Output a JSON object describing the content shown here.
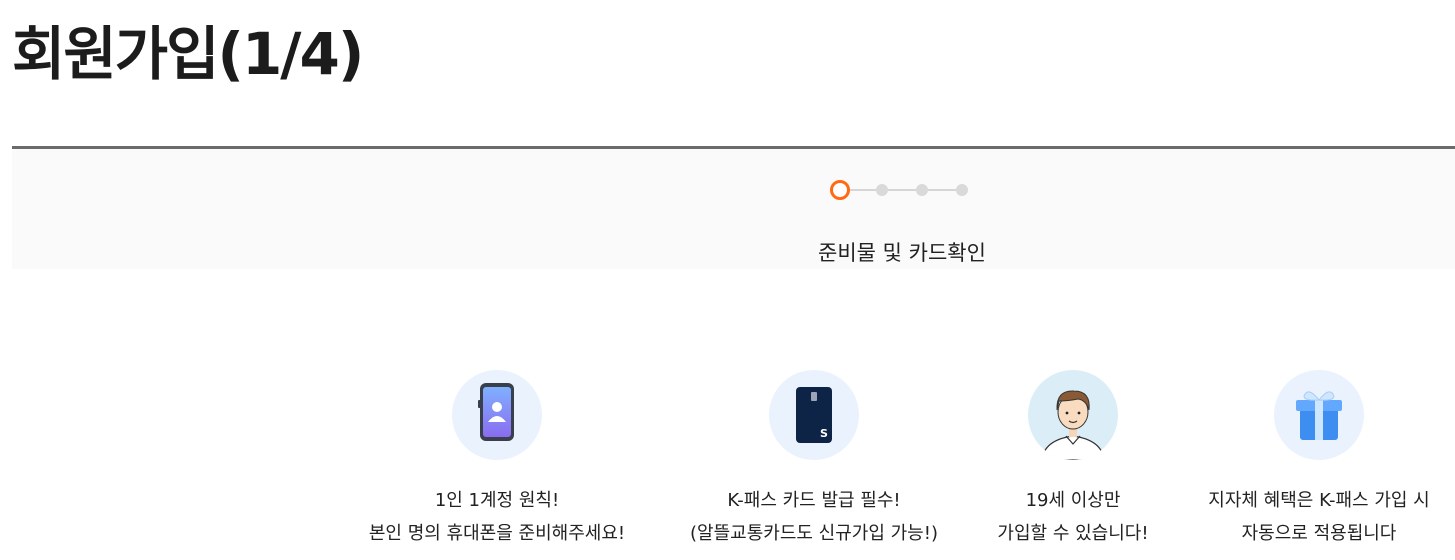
{
  "page": {
    "title": "회원가입(1/4)"
  },
  "stepper": {
    "current_step_label": "준비물 및 카드확인",
    "colors": {
      "active": "#ff6a13",
      "inactive": "#d9d9d9"
    }
  },
  "info_items": [
    {
      "icon": "smartphone-user-icon",
      "line1": "1인 1계정 원칙!",
      "line2": "본인 명의 휴대폰을 준비해주세요!"
    },
    {
      "icon": "kpass-card-icon",
      "line1": "K-패스 카드 발급 필수!",
      "line2": "(알뜰교통카드도 신규가입 가능!)"
    },
    {
      "icon": "adult-person-icon",
      "line1": "19세 이상만",
      "line2": "가입할 수 있습니다!"
    },
    {
      "icon": "gift-box-icon",
      "line1": "지자체 혜택은 K-패스 가입 시",
      "line2": "자동으로 적용됩니다"
    }
  ]
}
